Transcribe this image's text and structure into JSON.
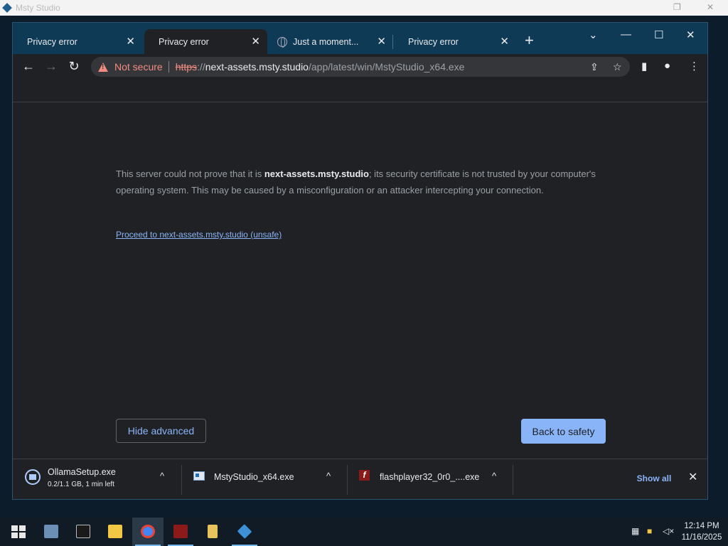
{
  "background_app": {
    "title": "Msty Studio",
    "restore_glyph": "❐",
    "close_glyph": "✕"
  },
  "browser": {
    "tabs": [
      {
        "label": "Privacy error",
        "active": false
      },
      {
        "label": "Privacy error",
        "active": true
      },
      {
        "label": "Just a moment...",
        "active": false,
        "icon": "globe-icon"
      },
      {
        "label": "Privacy error",
        "active": false
      }
    ],
    "tab_close_glyph": "✕",
    "new_tab_glyph": "+",
    "window_controls": {
      "tab_search_glyph": "⌄",
      "minimize_glyph": "—",
      "maximize_glyph": "☐",
      "close_glyph": "✕"
    },
    "toolbar": {
      "back_glyph": "←",
      "forward_glyph": "→",
      "reload_glyph": "↻",
      "security_label": "Not secure",
      "url": {
        "scheme": "https",
        "separator": "://",
        "host": "next-assets.msty.studio",
        "path": "/app/latest/win/MstyStudio_x64.exe"
      },
      "share_glyph": "⇪",
      "bookmark_glyph": "☆",
      "sidepanel_glyph": "▮",
      "profile_glyph": "●",
      "menu_glyph": "⋮",
      "extra_glyph": "✲"
    }
  },
  "page": {
    "explanation": {
      "prefix": "This server could not prove that it is ",
      "host": "next-assets.msty.studio",
      "suffix": "; its security certificate is not trusted by your computer's operating system. This may be caused by a misconfiguration or an attacker intercepting your connection."
    },
    "proceed_link": "Proceed to next-assets.msty.studio (unsafe)",
    "hide_advanced_label": "Hide advanced",
    "back_to_safety_label": "Back to safety"
  },
  "downloads": {
    "items": [
      {
        "name": "OllamaSetup.exe",
        "status": "0.2/1.1 GB, 1 min left",
        "icon": "ollama-icon"
      },
      {
        "name": "MstyStudio_x64.exe",
        "status": "",
        "icon": "installer-icon"
      },
      {
        "name": "flashplayer32_0r0_....exe",
        "status": "",
        "icon": "flash-icon"
      }
    ],
    "chevron_glyph": "^",
    "show_all_label": "Show all",
    "close_glyph": "✕"
  },
  "taskbar": {
    "apps": [
      {
        "name": "server-manager",
        "color": "#6b8fb5"
      },
      {
        "name": "command-prompt",
        "color": "#1a1a1a"
      },
      {
        "name": "file-explorer",
        "color": "#f2c744"
      },
      {
        "name": "chrome",
        "color": "#4285f4"
      },
      {
        "name": "flash-player",
        "color": "#8b1a1a"
      },
      {
        "name": "archive",
        "color": "#e6c35c"
      },
      {
        "name": "msty-studio",
        "color": "#3d8fd6"
      }
    ],
    "time": "12:14 PM",
    "date": "11/16/2025"
  }
}
